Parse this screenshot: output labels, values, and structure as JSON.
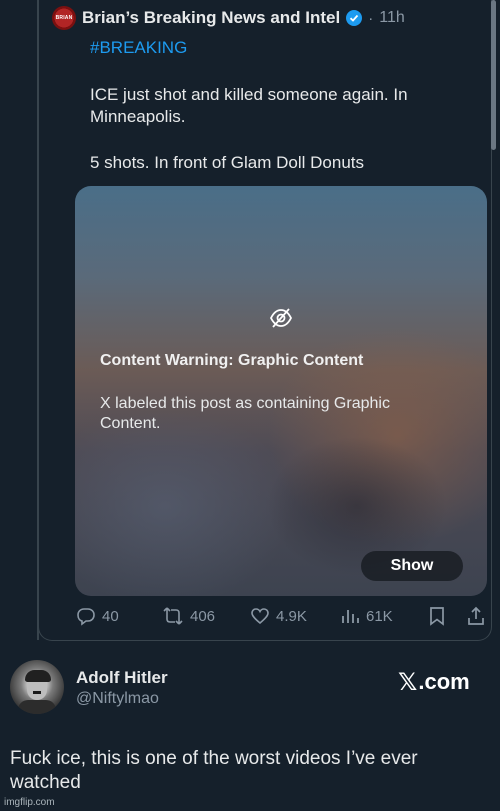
{
  "quoted_tweet": {
    "avatar_text": "BRIAN",
    "author_name": "Brian’s Breaking News and Intel",
    "time_separator": "·",
    "time": "11h",
    "hashtag": "#BREAKING",
    "line1": "ICE just shot and killed someone again.  In",
    "line2": "Minneapolis.",
    "line3": "5 shots.  In front of Glam Doll Donuts",
    "content_warning": {
      "title": "Content Warning: Graphic Content",
      "body": "X labeled this post as containing Graphic Content.",
      "show_label": "Show"
    },
    "actions": {
      "replies": "40",
      "reposts": "406",
      "likes": "4.9K",
      "views": "61K"
    }
  },
  "reply": {
    "name": "Adolf Hitler",
    "handle": "@Niftylmao",
    "site_x": "𝕏",
    "site_rest": ".com",
    "text": "Fuck ice, this is one of the worst videos I’ve ever watched"
  },
  "watermark": "imgflip.com",
  "colors": {
    "background": "#15202b",
    "accent": "#1d9bf0",
    "muted": "#8b98a5"
  }
}
